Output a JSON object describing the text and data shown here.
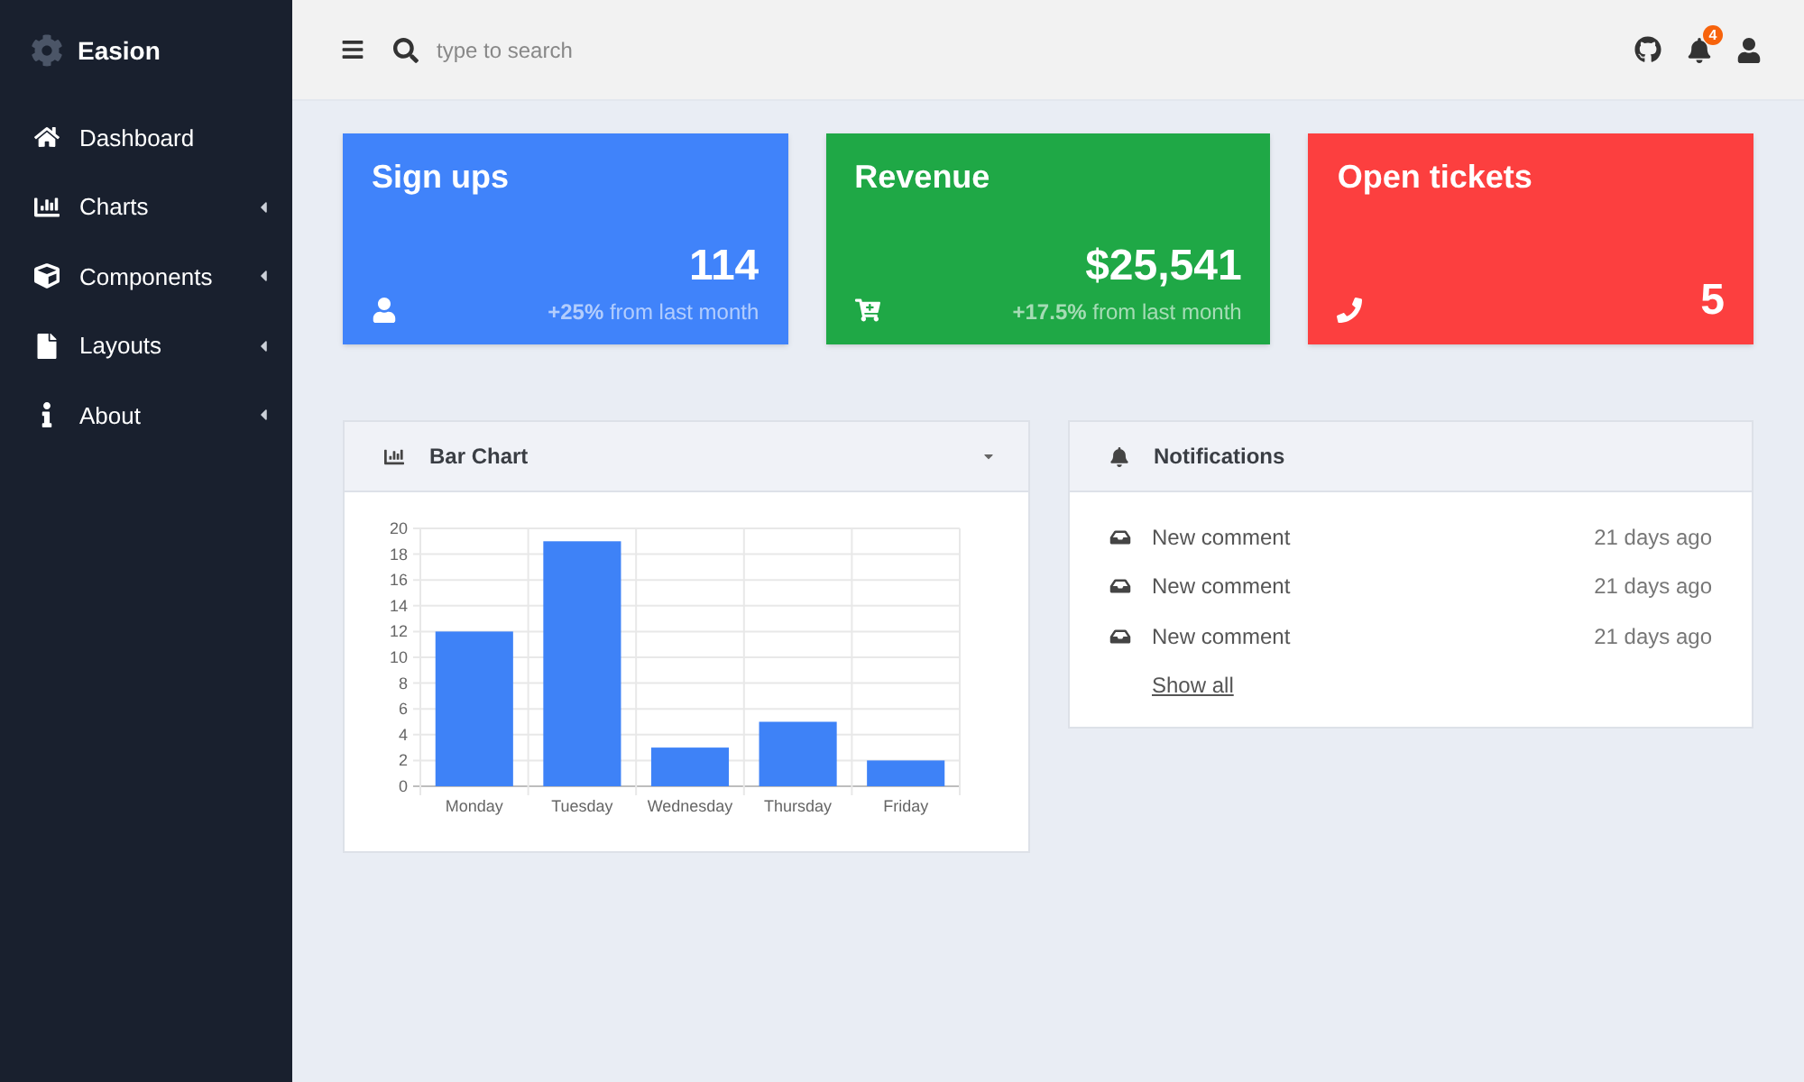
{
  "sidebar": {
    "brand": "Easion",
    "items": [
      {
        "label": "Dashboard",
        "submenu": false
      },
      {
        "label": "Charts",
        "submenu": true
      },
      {
        "label": "Components",
        "submenu": true
      },
      {
        "label": "Layouts",
        "submenu": true
      },
      {
        "label": "About",
        "submenu": true
      }
    ]
  },
  "topbar": {
    "search": {
      "placeholder": "type to search"
    },
    "notifications_badge": "4"
  },
  "cards": [
    {
      "title": "Sign ups",
      "value": "114",
      "note": "**+25%** from last month",
      "color": "#4083fa"
    },
    {
      "title": "Revenue",
      "value": "$25,541",
      "note": "**+17.5%** from last month",
      "color": "#1fa846"
    },
    {
      "title": "Open tickets",
      "value": "5",
      "color": "#fc3f3f"
    }
  ],
  "bar_chart_panel": {
    "title": "Bar Chart",
    "chart_data": [
      {
        "type": "bar",
        "categories": [
          "Monday",
          "Tuesday",
          "Wednesday",
          "Thursday",
          "Friday"
        ],
        "values": [
          12,
          19,
          3,
          5,
          2
        ],
        "color": "#3e82f7",
        "ylim": [
          0,
          20
        ],
        "yticks": [
          0,
          2,
          4,
          6,
          8,
          10,
          12,
          14,
          16,
          18,
          20
        ],
        "grid": true
      }
    ]
  },
  "notifications": {
    "title": "Notifications",
    "items": [
      {
        "text": "New comment",
        "time": "21 days ago"
      },
      {
        "text": "New comment",
        "time": "21 days ago"
      },
      {
        "text": "New comment",
        "time": "21 days ago"
      }
    ],
    "show_all": "Show all"
  }
}
